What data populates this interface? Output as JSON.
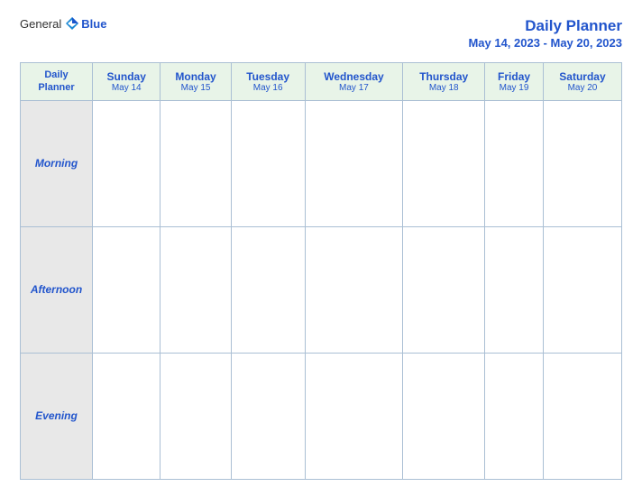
{
  "logo": {
    "general": "General",
    "blue": "Blue"
  },
  "title": "Daily Planner",
  "date_range": "May 14, 2023 - May 20, 2023",
  "table": {
    "header_cell": "Daily\nPlanner",
    "days": [
      {
        "name": "Sunday",
        "date": "May 14"
      },
      {
        "name": "Monday",
        "date": "May 15"
      },
      {
        "name": "Tuesday",
        "date": "May 16"
      },
      {
        "name": "Wednesday",
        "date": "May 17"
      },
      {
        "name": "Thursday",
        "date": "May 18"
      },
      {
        "name": "Friday",
        "date": "May 19"
      },
      {
        "name": "Saturday",
        "date": "May 20"
      }
    ],
    "rows": [
      {
        "label": "Morning"
      },
      {
        "label": "Afternoon"
      },
      {
        "label": "Evening"
      }
    ]
  }
}
